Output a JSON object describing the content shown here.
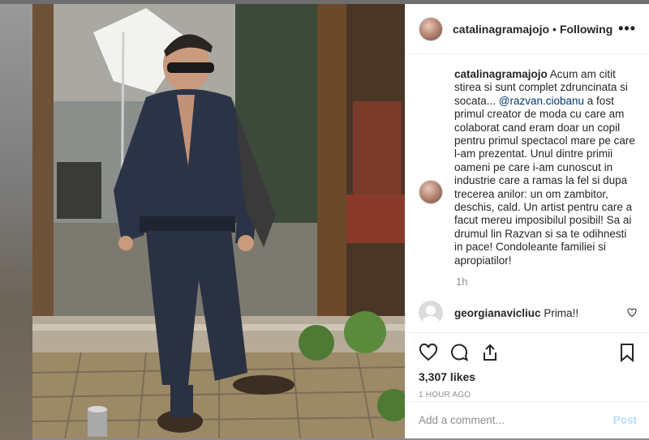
{
  "post": {
    "username": "catalinagramajojo",
    "follow_status": "Following",
    "separator": "•",
    "more_glyph": "•••"
  },
  "caption": {
    "username": "catalinagramajojo",
    "text_before": " Acum am citit stirea si sunt complet zdruncinata si socata... ",
    "mention": "@razvan.ciobanu",
    "text_after": " a fost primul creator de moda cu care am colaborat cand eram doar un copil pentru primul spectacol mare pe care l-am prezentat. Unul dintre primii oameni pe care i-am cunoscut in industrie care a ramas la fel si dupa trecerea anilor: un om zambitor, deschis, cald. Un artist pentru care a facut mereu imposibilul posibil! Sa ai drumul lin Razvan si sa te odihnesti in pace! Condoleante familiei si apropiatilor!",
    "time": "1h"
  },
  "comment": {
    "username": "georgianavicliuc",
    "text": "Prima!!"
  },
  "stats": {
    "likes": "3,307 likes",
    "posted": "1 HOUR AGO"
  },
  "add_comment": {
    "placeholder": "Add a comment...",
    "post_label": "Post"
  },
  "colors": {
    "text": "#262626",
    "muted": "#8e8e8e",
    "mention": "#00376b",
    "post_disabled": "#b2dffc",
    "border": "#efefef"
  },
  "icons": [
    "heart-icon",
    "comment-icon",
    "share-icon",
    "bookmark-icon",
    "more-icon",
    "small-heart-icon"
  ]
}
